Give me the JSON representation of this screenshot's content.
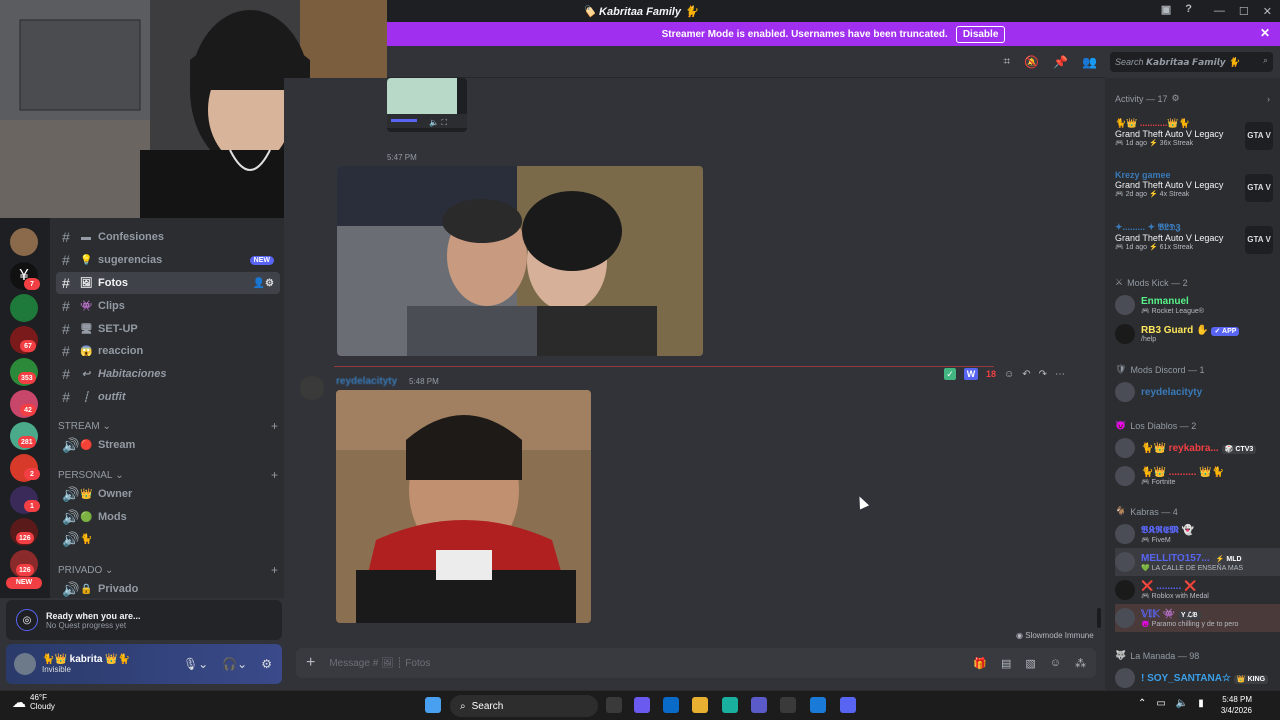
{
  "window": {
    "title": "🏷️ Kabritaa Family 🐈"
  },
  "banner": {
    "text": "Streamer Mode is enabled. Usernames have been truncated.",
    "button": "Disable"
  },
  "search": {
    "placeholder": "Search 𝙆𝙖𝙗𝙧𝙞𝙩𝙖𝙖 𝙁𝙖𝙢𝙞𝙡𝙮 🐈"
  },
  "rail_badges": [
    "7",
    "67",
    "353",
    "42",
    "281",
    "2",
    "1",
    "126",
    "126"
  ],
  "rail_new": "NEW",
  "channels": [
    {
      "emoji": "▬",
      "label": "Confesiones"
    },
    {
      "emoji": "💡",
      "label": "sugerencias",
      "pill": "NEW"
    },
    {
      "emoji": "🖼",
      "label": "Fotos",
      "selected": true
    },
    {
      "emoji": "👾",
      "label": "Clips"
    },
    {
      "emoji": "🖥",
      "label": "SET-UP"
    },
    {
      "emoji": "😱",
      "label": "reaccion"
    },
    {
      "emoji": "↩",
      "label": "Habitaciones"
    },
    {
      "emoji": "┊",
      "label": "outfit"
    }
  ],
  "categories": {
    "stream": "STREAM",
    "personal": "PERSONAL",
    "privado": "PRIVADO"
  },
  "voice": {
    "stream": "Stream",
    "owner": "Owner",
    "mods": "Mods",
    "privado": "Privado"
  },
  "quest": {
    "title": "Ready when you are...",
    "sub": "No Quest progress yet"
  },
  "user": {
    "name": "🐈👑 kabrita 👑🐈",
    "status": "Invisible"
  },
  "messages": {
    "ts1": "5:47 PM",
    "author2": "reydelacityty",
    "ts2": "5:48 PM",
    "reaction_count": "18",
    "slowmode": "Slowmode Immune"
  },
  "composer": {
    "placeholder": "Message # 🖼 ┊ Fotos"
  },
  "members": {
    "activity_header": "Activity — 17",
    "activities": [
      {
        "user": "🐈👑 ...........👑🐈",
        "game": "Grand Theft Auto V Legacy",
        "meta": "🎮 1d ago  ⚡ 36x Streak",
        "icon": "GTA V"
      },
      {
        "user": "Krezy gamee",
        "game": "Grand Theft Auto V Legacy",
        "meta": "🎮 2d ago  ⚡ 4x Streak",
        "icon": "GTA V"
      },
      {
        "user": "✦......... ✦ 𝕭𝕷𝕯𝖅",
        "game": "Grand Theft Auto V Legacy",
        "meta": "🎮 1d ago  ⚡ 61x Streak",
        "icon": "GTA V"
      }
    ],
    "mods_kick_header": "Mods Kick — 2",
    "mods_kick": [
      {
        "name": "Enmanuel",
        "sub": "🎮 Rocket League®",
        "color": "#57f287"
      },
      {
        "name": "RB3 Guard ✋",
        "sub": "/help",
        "color": "#fee75c",
        "tag": "✓ APP"
      }
    ],
    "mods_discord_header": "Mods Discord — 1",
    "mods_discord": [
      {
        "name": "reydelacityty",
        "sub": "",
        "color": "#3a7ab8"
      }
    ],
    "diablos_header": "Los Diablos — 2",
    "diablos": [
      {
        "name": "🐈👑 reykabra...",
        "sub": "",
        "color": "#f23f43",
        "tag": "🎲 CTV3"
      },
      {
        "name": "🐈👑 .......... 👑🐈",
        "sub": "🎮 Fortnite",
        "color": "#f23f43"
      }
    ],
    "kabras_header": "Kabras — 4",
    "kabras": [
      {
        "name": "𝕭𝕶𝕽𝕰𝕸 👻",
        "sub": "🎮 FiveM",
        "color": "#5865f2"
      },
      {
        "name": "MELLITO157...",
        "sub": "💚 LA CALLE DE ENSEÑA MAS",
        "color": "#5865f2",
        "tag": "⚡ MLD"
      },
      {
        "name": "❌ ......... ❌",
        "sub": "🎮 Roblox with Medal",
        "color": "#5865f2"
      },
      {
        "name": "𝕍𝕀𝕂 👾",
        "sub": "😈 Paramo chilling y de to pero",
        "color": "#5865f2",
        "tag": "Y ℒ𝔅"
      }
    ],
    "manada_header": "La Manada — 98",
    "manada": [
      {
        "name": "! SOY_SANTANA☆",
        "sub": "",
        "color": "#3a9fe8",
        "tag": "👑 KING"
      }
    ]
  },
  "taskbar": {
    "temp": "46°F",
    "weather": "Cloudy",
    "search": "Search",
    "time": "5:48 PM",
    "date": "3/4/2026"
  }
}
